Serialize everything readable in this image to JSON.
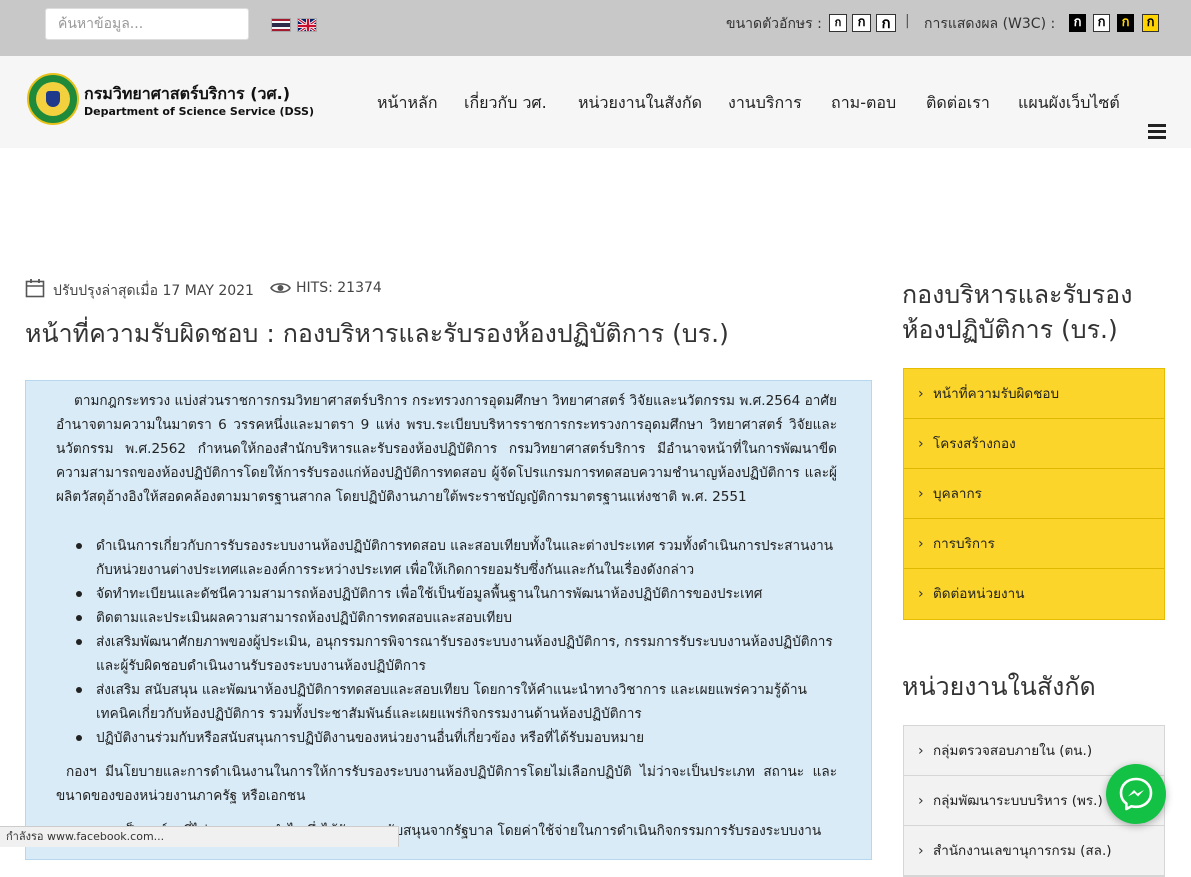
{
  "topbar": {
    "search_placeholder": "ค้นหาข้อมูล...",
    "font_size_label": "ขนาดตัวอักษร :",
    "font_buttons": [
      "ก",
      "ก",
      "ก"
    ],
    "separator": "|",
    "display_label": "การแสดงผล (W3C) :",
    "contrast_buttons": [
      "ก",
      "ก",
      "ก",
      "ก"
    ]
  },
  "header": {
    "brand_th": "กรมวิทยาศาสตร์บริการ (วศ.)",
    "brand_en": "Department of Science Service (DSS)",
    "nav": [
      "หน้าหลัก",
      "เกี่ยวกับ วศ.",
      "หน่วยงานในสังกัด",
      "งานบริการ",
      "ถาม-ตอบ",
      "ติดต่อเรา",
      "แผนผังเว็บไซต์"
    ]
  },
  "article": {
    "updated": "ปรับปรุงล่าสุดเมื่อ 17 MAY 2021",
    "hits": "HITS: 21374",
    "title": "หน้าที่ความรับผิดชอบ : กองบริหารและรับรองห้องปฏิบัติการ (บร.)",
    "intro": "ตามกฎกระทรวง แบ่งส่วนราชการกรมวิทยาศาสตร์บริการ กระทรวงการอุดมศึกษา วิทยาศาสตร์ วิจัยและนวัตกรรม พ.ศ.2564 อาศัยอำนาจตามความในมาตรา 6 วรรคหนึ่งและมาตรา 9 แห่ง พรบ.ระเบียบบริหารราชการกระทรวงการอุดมศึกษา วิทยาศาสตร์ วิจัยและนวัตกรรม พ.ศ.2562 กำหนดให้กองสำนักบริหารและรับรองห้องปฏิบัติการ กรมวิทยาศาสตร์บริการ มีอำนาจหน้าที่ในการพัฒนาขีดความสามารถของห้องปฏิบัติการโดยให้การรับรองแก่ห้องปฏิบัติการทดสอบ ผู้จัดโปรแกรมการทดสอบความชำนาญห้องปฏิบัติการ และผู้ผลิตวัสดุอ้างอิงให้สอดคล้องตามมาตรฐานสากล โดยปฏิบัติงานภายใต้พระราชบัญญัติการมาตรฐานแห่งชาติ พ.ศ. 2551",
    "duties": [
      "ดำเนินการเกี่ยวกับการรับรองระบบงานห้องปฏิบัติการทดสอบ และสอบเทียบทั้งในและต่างประเทศ รวมทั้งดำเนินการประสานงานกับหน่วยงานต่างประเทศและองค์การระหว่างประเทศ เพื่อให้เกิดการยอมรับซึ่งกันและกันในเรื่องดังกล่าว",
      "จัดทำทะเบียนและดัชนีความสามารถห้องปฏิบัติการ เพื่อใช้เป็นข้อมูลพื้นฐานในการพัฒนาห้องปฏิบัติการของประเทศ",
      "ติดตามและประเมินผลความสามารถห้องปฏิบัติการทดสอบและสอบเทียบ",
      "ส่งเสริมพัฒนาศักยภาพของผู้ประเมิน, อนุกรรมการพิจารณารับรองระบบงานห้องปฏิบัติการ, กรรมการรับระบบงานห้องปฏิบัติการ และผู้รับผิดชอบดำเนินงานรับรองระบบงานห้องปฏิบัติการ",
      "ส่งเสริม สนับสนุน และพัฒนาห้องปฏิบัติการทดสอบและสอบเทียบ โดยการให้คำแนะนำทางวิชาการ และเผยแพร่ความรู้ด้านเทคนิคเกี่ยวกับห้องปฏิบัติการ รวมทั้งประชาสัมพันธ์และเผยแพร่กิจกรรมงานด้านห้องปฏิบัติการ",
      "ปฏิบัติงานร่วมกับหรือสนับสนุนการปฏิบัติงานของหน่วยงานอื่นที่เกี่ยวข้อง หรือที่ได้รับมอบหมาย"
    ],
    "policy": "กองฯ มีนโยบายและการดำเนินงานในการให้การรับรองระบบงานห้องปฏิบัติการโดยไม่เลือกปฏิบัติ ไม่ว่าจะเป็นประเภท สถานะ และขนาดของของหน่วยงานภาครัฐ หรือเอกชน",
    "cost": "กองฯ เป็นองค์กรที่ไม่แสวงหาผลกำไร ซึ่งได้รับการสนับสนุนจากรัฐบาล โดยค่าใช้จ่ายในการดำเนินกิจกรรมการรับรองระบบงาน"
  },
  "sidebar": {
    "division_title_1": "กองบริหารและรับรอง",
    "division_title_2": "ห้องปฏิบัติการ (บร.)",
    "division_menu": [
      "หน้าที่ความรับผิดชอบ",
      "โครงสร้างกอง",
      "บุคลากร",
      "การบริการ",
      "ติดต่อหน่วยงาน"
    ],
    "units_title": "หน่วยงานในสังกัด",
    "units_menu": [
      "กลุ่มตรวจสอบภายใน (ตน.)",
      "กลุ่มพัฒนาระบบบริหาร (พร.)",
      "สำนักงานเลขานุการกรม (สล.)"
    ]
  },
  "statusbar": {
    "text": "กำลังรอ www.facebook.com..."
  },
  "icons": {
    "messenger": "messenger-icon",
    "calendar": "calendar-icon",
    "views": "eye-icon",
    "menu": "hamburger-menu-icon"
  },
  "colors": {
    "topbar": "#c8c8c8",
    "content_bg": "#d9ebf7",
    "sidebar_accent": "#fbd52a",
    "messenger": "#13c244"
  }
}
